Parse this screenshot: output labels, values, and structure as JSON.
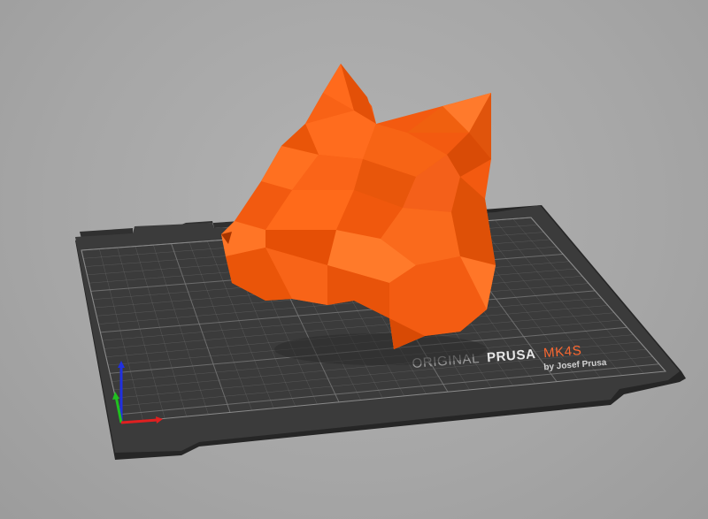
{
  "viewport": {
    "background": "#a9a9a9"
  },
  "bed": {
    "brand_light": "ORIGINAL",
    "brand_bold": "PRUSA",
    "model": "MK4S",
    "byline": "by Josef Prusa",
    "bed_color": "#3a3a3a",
    "frame_color": "#2c2c2c",
    "grid_color": "#7a7a7a",
    "accent_color": "#fa6831"
  },
  "model": {
    "name": "low-poly-fox-head",
    "color": "#fa5e0f"
  },
  "axes": {
    "x_color": "#e02020",
    "y_color": "#20c020",
    "z_color": "#2030e0"
  }
}
